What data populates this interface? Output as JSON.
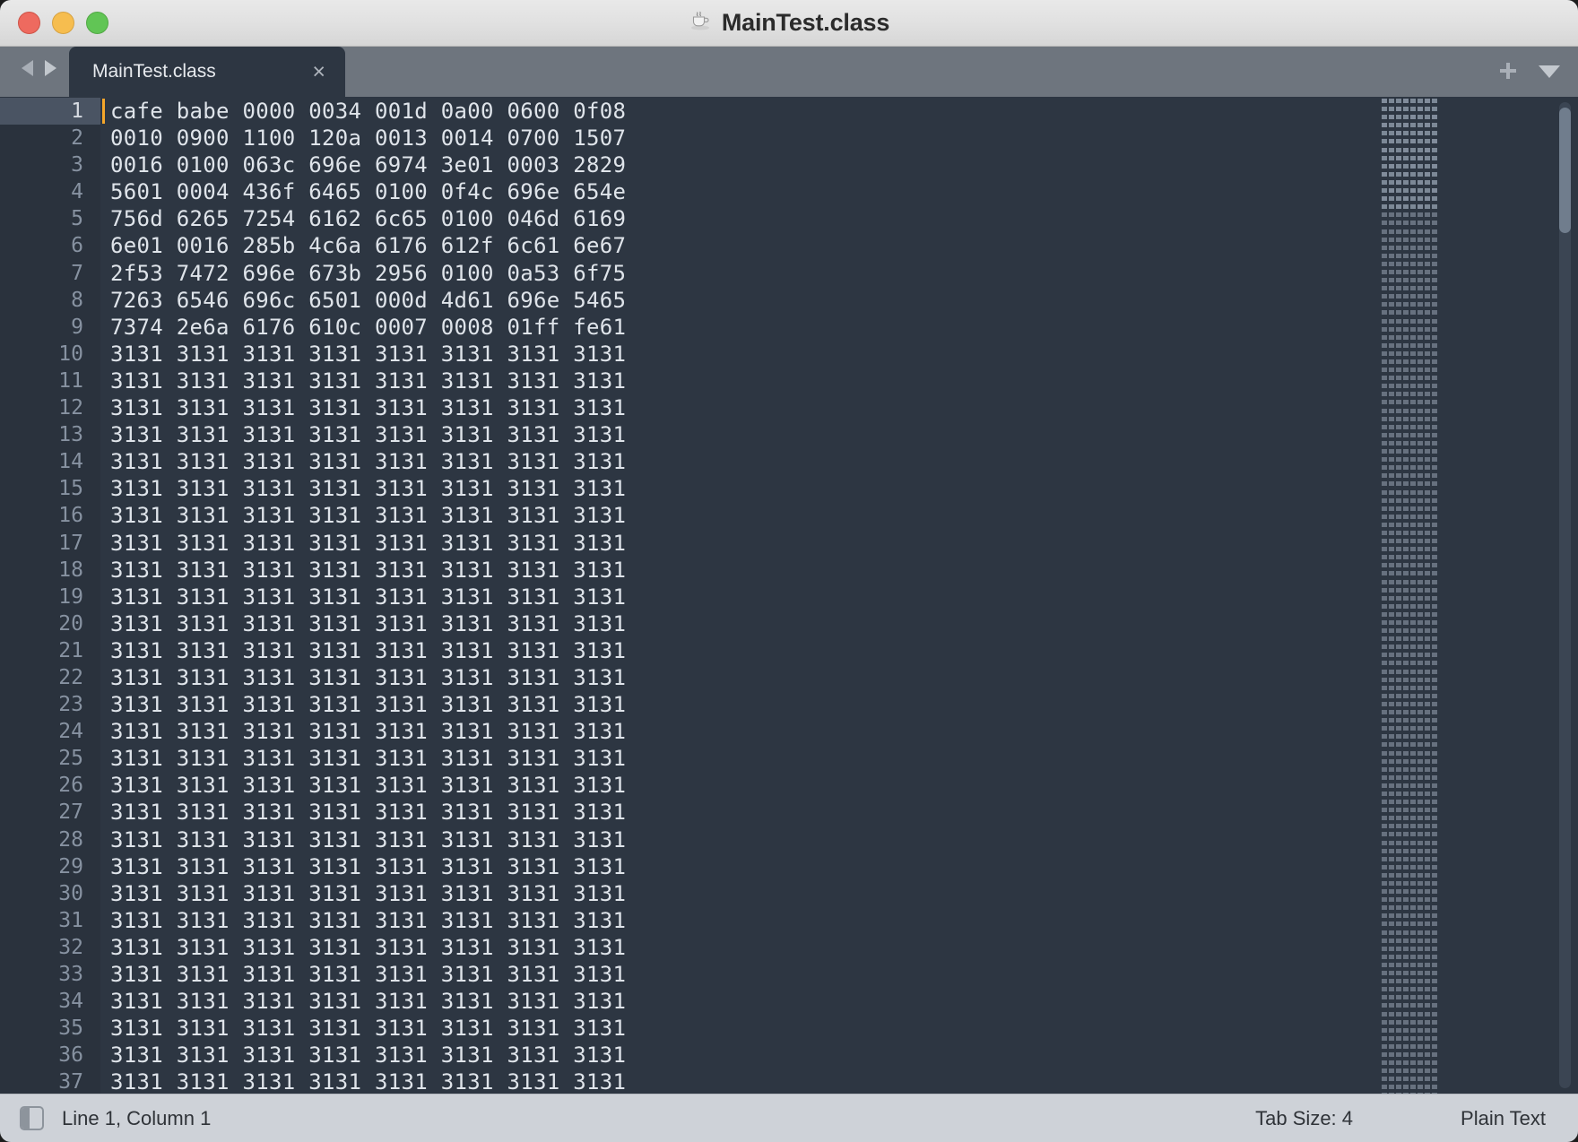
{
  "window": {
    "title": "MainTest.class",
    "title_icon": "java-coffee-cup-icon",
    "traffic_lights": {
      "close": "close-window-button",
      "minimize": "minimize-window-button",
      "maximize": "maximize-window-button"
    },
    "colors": {
      "titlebar": "#e0e0e0",
      "tabbar": "#6e757e",
      "editor_bg": "#2d3642",
      "gutter_bg": "#2a323d",
      "active_gutter_bg": "#4a5463",
      "code_fg": "#dfe4ea",
      "line_number_fg": "#8792a1",
      "cursor": "#f4a62a",
      "statusbar_bg": "#ced2d8",
      "traffic_red": "#ee6a5f",
      "traffic_yellow": "#f6bd4f",
      "traffic_green": "#61c555"
    }
  },
  "tabbar": {
    "nav_back": "nav-back-arrow",
    "nav_forward": "nav-forward-arrow",
    "tabs": [
      {
        "label": "MainTest.class",
        "close": "×",
        "active": true
      }
    ],
    "new_tab": "+",
    "tab_menu": "▼"
  },
  "editor": {
    "cursor_line": 1,
    "first_visible_line": 1,
    "last_visible_line": 37,
    "lines": [
      {
        "n": "1",
        "text": "cafe babe 0000 0034 001d 0a00 0600 0f08"
      },
      {
        "n": "2",
        "text": "0010 0900 1100 120a 0013 0014 0700 1507"
      },
      {
        "n": "3",
        "text": "0016 0100 063c 696e 6974 3e01 0003 2829"
      },
      {
        "n": "4",
        "text": "5601 0004 436f 6465 0100 0f4c 696e 654e"
      },
      {
        "n": "5",
        "text": "756d 6265 7254 6162 6c65 0100 046d 6169"
      },
      {
        "n": "6",
        "text": "6e01 0016 285b 4c6a 6176 612f 6c61 6e67"
      },
      {
        "n": "7",
        "text": "2f53 7472 696e 673b 2956 0100 0a53 6f75"
      },
      {
        "n": "8",
        "text": "7263 6546 696c 6501 000d 4d61 696e 5465"
      },
      {
        "n": "9",
        "text": "7374 2e6a 6176 610c 0007 0008 01ff fe61"
      },
      {
        "n": "10",
        "text": "3131 3131 3131 3131 3131 3131 3131 3131"
      },
      {
        "n": "11",
        "text": "3131 3131 3131 3131 3131 3131 3131 3131"
      },
      {
        "n": "12",
        "text": "3131 3131 3131 3131 3131 3131 3131 3131"
      },
      {
        "n": "13",
        "text": "3131 3131 3131 3131 3131 3131 3131 3131"
      },
      {
        "n": "14",
        "text": "3131 3131 3131 3131 3131 3131 3131 3131"
      },
      {
        "n": "15",
        "text": "3131 3131 3131 3131 3131 3131 3131 3131"
      },
      {
        "n": "16",
        "text": "3131 3131 3131 3131 3131 3131 3131 3131"
      },
      {
        "n": "17",
        "text": "3131 3131 3131 3131 3131 3131 3131 3131"
      },
      {
        "n": "18",
        "text": "3131 3131 3131 3131 3131 3131 3131 3131"
      },
      {
        "n": "19",
        "text": "3131 3131 3131 3131 3131 3131 3131 3131"
      },
      {
        "n": "20",
        "text": "3131 3131 3131 3131 3131 3131 3131 3131"
      },
      {
        "n": "21",
        "text": "3131 3131 3131 3131 3131 3131 3131 3131"
      },
      {
        "n": "22",
        "text": "3131 3131 3131 3131 3131 3131 3131 3131"
      },
      {
        "n": "23",
        "text": "3131 3131 3131 3131 3131 3131 3131 3131"
      },
      {
        "n": "24",
        "text": "3131 3131 3131 3131 3131 3131 3131 3131"
      },
      {
        "n": "25",
        "text": "3131 3131 3131 3131 3131 3131 3131 3131"
      },
      {
        "n": "26",
        "text": "3131 3131 3131 3131 3131 3131 3131 3131"
      },
      {
        "n": "27",
        "text": "3131 3131 3131 3131 3131 3131 3131 3131"
      },
      {
        "n": "28",
        "text": "3131 3131 3131 3131 3131 3131 3131 3131"
      },
      {
        "n": "29",
        "text": "3131 3131 3131 3131 3131 3131 3131 3131"
      },
      {
        "n": "30",
        "text": "3131 3131 3131 3131 3131 3131 3131 3131"
      },
      {
        "n": "31",
        "text": "3131 3131 3131 3131 3131 3131 3131 3131"
      },
      {
        "n": "32",
        "text": "3131 3131 3131 3131 3131 3131 3131 3131"
      },
      {
        "n": "33",
        "text": "3131 3131 3131 3131 3131 3131 3131 3131"
      },
      {
        "n": "34",
        "text": "3131 3131 3131 3131 3131 3131 3131 3131"
      },
      {
        "n": "35",
        "text": "3131 3131 3131 3131 3131 3131 3131 3131"
      },
      {
        "n": "36",
        "text": "3131 3131 3131 3131 3131 3131 3131 3131"
      },
      {
        "n": "37",
        "text": "3131 3131 3131 3131 3131 3131 3131 3131"
      }
    ]
  },
  "statusbar": {
    "sidebar_toggle": "sidebar-toggle-icon",
    "position": "Line 1, Column 1",
    "tab_size": "Tab Size: 4",
    "syntax": "Plain Text"
  }
}
